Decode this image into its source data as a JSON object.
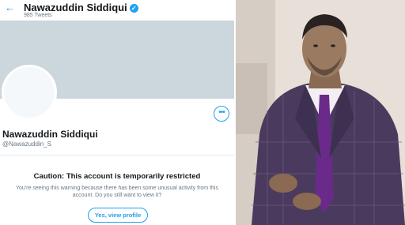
{
  "header": {
    "name": "Nawazuddin Siddiqui",
    "tweets": "985 Tweets"
  },
  "profile": {
    "name": "Nawazuddin Siddiqui",
    "handle": "@Nawazuddin_S"
  },
  "notice": {
    "title": "Caution: This account is temporarily restricted",
    "message": "You're seeing this warning because there has been some unusual activity from this account. Do you still want to view it?",
    "button": "Yes, view profile"
  },
  "icons": {
    "back": "arrow-left-icon",
    "verified": "verified-badge-icon",
    "more": "more-options-icon"
  },
  "colors": {
    "accent": "#1da1f2",
    "banner": "#ccd6dd",
    "suit": "#4a3b5e",
    "tie": "#6a2a8a"
  }
}
